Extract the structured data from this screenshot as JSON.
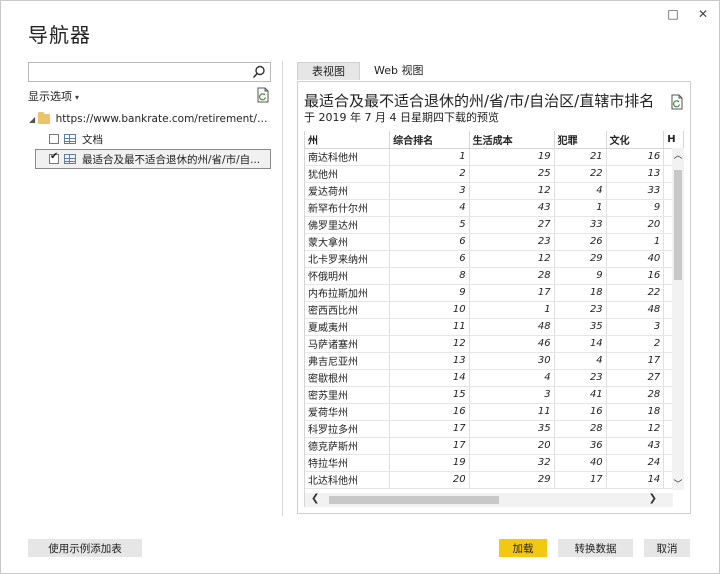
{
  "window": {
    "title": "导航器",
    "controls": [
      "□",
      "✕"
    ]
  },
  "left": {
    "search": {
      "value": "",
      "placeholder": ""
    },
    "display_options": "显示选项",
    "tree": {
      "root_url": "https://www.bankrate.com/retirement/best-an...",
      "items": [
        {
          "label": "文档",
          "checked": false
        },
        {
          "label": "最适合及最不适合退休的州/省/市/自...",
          "checked": true
        }
      ]
    }
  },
  "right": {
    "tabs": [
      "表视图",
      "Web 视图"
    ],
    "preview_title": "最适合及最不适合退休的州/省/市/自治区/直辖市排名",
    "preview_subtitle": "于 2019 年 7 月 4 日星期四下载的预览",
    "columns": [
      "州",
      "综合排名",
      "生活成本",
      "犯罪",
      "文化",
      "H"
    ],
    "rows": [
      [
        "南达科他州",
        "1",
        "19",
        "21",
        "16"
      ],
      [
        "犹他州",
        "2",
        "25",
        "22",
        "13"
      ],
      [
        "爱达荷州",
        "3",
        "12",
        "4",
        "33"
      ],
      [
        "新罕布什尔州",
        "4",
        "43",
        "1",
        "9"
      ],
      [
        "佛罗里达州",
        "5",
        "27",
        "33",
        "20"
      ],
      [
        "蒙大拿州",
        "6",
        "23",
        "26",
        "1"
      ],
      [
        "北卡罗来纳州",
        "6",
        "12",
        "29",
        "40"
      ],
      [
        "怀俄明州",
        "8",
        "28",
        "9",
        "16"
      ],
      [
        "内布拉斯加州",
        "9",
        "17",
        "18",
        "22"
      ],
      [
        "密西西比州",
        "10",
        "1",
        "23",
        "48"
      ],
      [
        "夏威夷州",
        "11",
        "48",
        "35",
        "3"
      ],
      [
        "马萨诸塞州",
        "12",
        "46",
        "14",
        "2"
      ],
      [
        "弗吉尼亚州",
        "13",
        "30",
        "4",
        "17"
      ],
      [
        "密歇根州",
        "14",
        "4",
        "23",
        "27"
      ],
      [
        "密苏里州",
        "15",
        "3",
        "41",
        "28"
      ],
      [
        "爱荷华州",
        "16",
        "11",
        "16",
        "18"
      ],
      [
        "科罗拉多州",
        "17",
        "35",
        "28",
        "12"
      ],
      [
        "德克萨斯州",
        "17",
        "20",
        "36",
        "43"
      ],
      [
        "特拉华州",
        "19",
        "32",
        "40",
        "24"
      ],
      [
        "北达科他州",
        "20",
        "29",
        "17",
        "14"
      ]
    ]
  },
  "footer": {
    "add_example": "使用示例添加表",
    "load": "加载",
    "transform": "转换数据",
    "cancel": "取消"
  },
  "colors": {
    "primary_button": "#f2c811",
    "button": "#e6e6e6"
  }
}
